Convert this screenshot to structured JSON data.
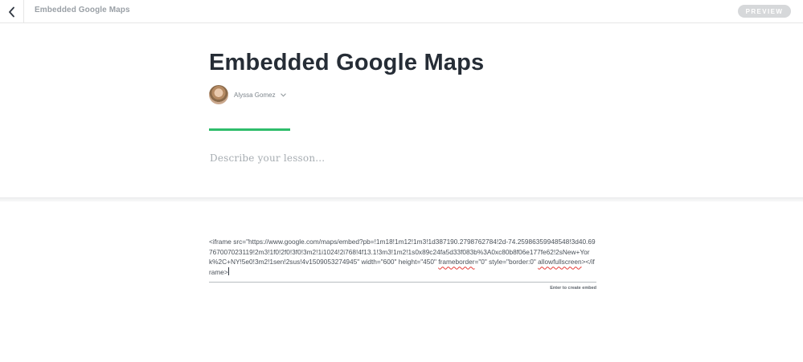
{
  "toolbar": {
    "back_icon": "chevron-left-icon",
    "doc_title": "Embedded Google Maps",
    "preview_label": "PREVIEW"
  },
  "lesson": {
    "title": "Embedded Google Maps",
    "author_name": "Alyssa Gomez",
    "author_menu_icon": "chevron-down-icon",
    "description_placeholder": "Describe your lesson...",
    "accent_color": "#2ebd6b"
  },
  "embed": {
    "code_part1": "<iframe src=\"https://www.google.com/maps/embed?pb=!1m18!1m12!1m3!1d387190.2798762784!2d-74.25986359948548!3d40.69767007023119!2m3!1f0!2f0!3f0!3m2!1i1024!2i768!4f13.1!3m3!1m2!1s0x89c24fa5d33f083b%3A0xc80b8f06e177fe62!2sNew+York%2C+NY!5e0!3m2!1sen!2sus!4v1509053274945\" width=\"600\" height=\"450\" ",
    "code_word_frameborder": "frameborder",
    "code_part2": "=\"0\" style=\"border:0\" ",
    "code_word_allowfullscreen": "allowfullscreen",
    "code_part3": "></iframe>",
    "hint": "Enter to create embed"
  }
}
